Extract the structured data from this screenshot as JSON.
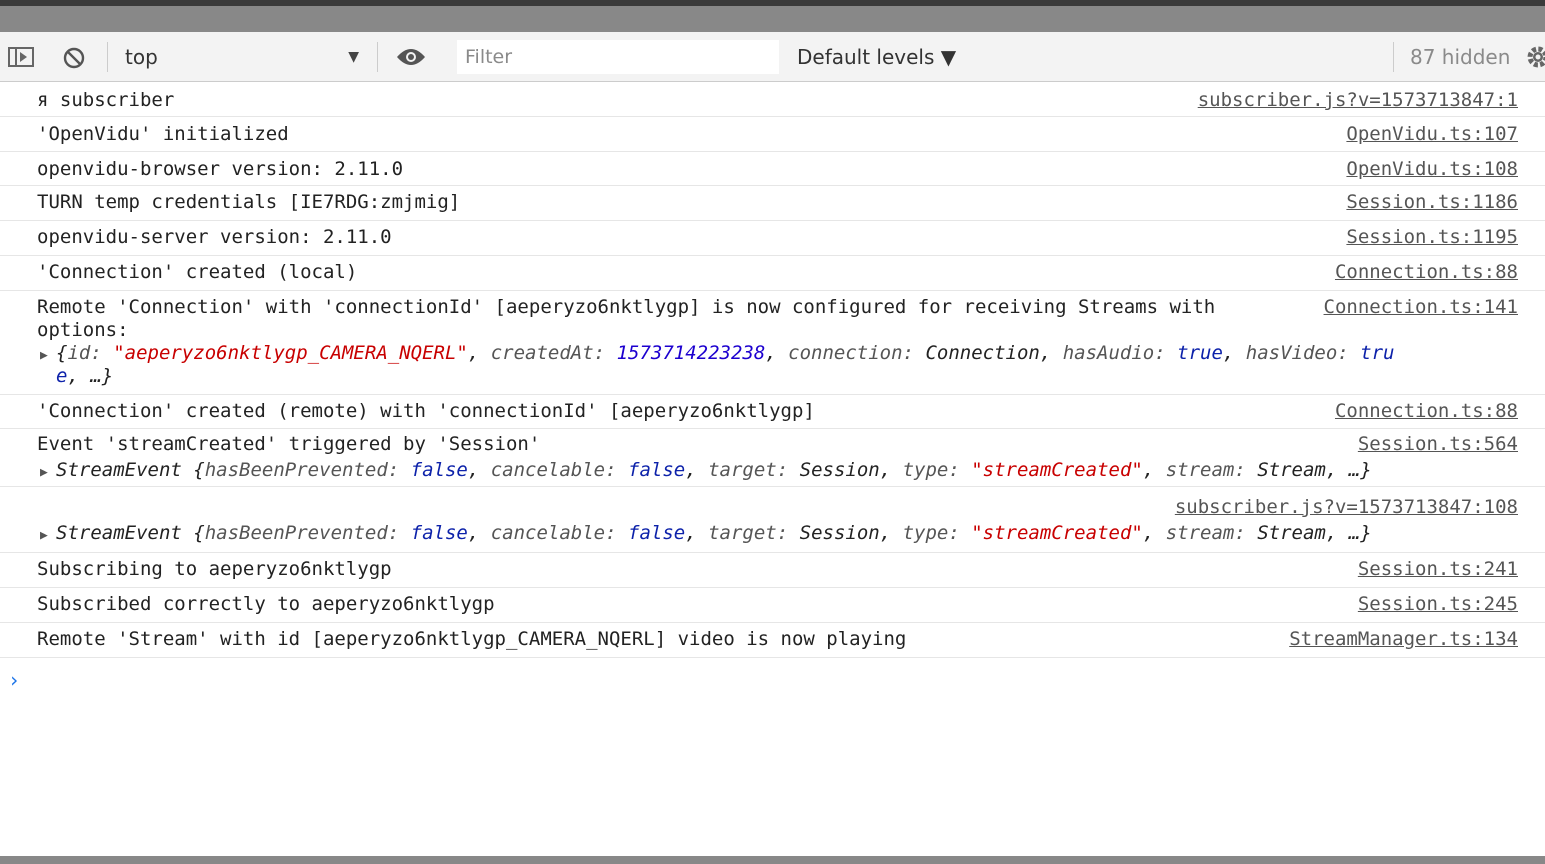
{
  "toolbar": {
    "context": "top",
    "filter_placeholder": "Filter",
    "levels_label": "Default levels ▼",
    "hidden_count": "87 hidden"
  },
  "console": {
    "rows": [
      {
        "text": "я subscriber",
        "source": "subscriber.js?v=1573713847:1"
      },
      {
        "text": "'OpenVidu' initialized",
        "source": "OpenVidu.ts:107"
      },
      {
        "text": "openvidu-browser version: 2.11.0",
        "source": "OpenVidu.ts:108"
      },
      {
        "text": "TURN temp credentials [IE7RDG:zmjmig]",
        "source": "Session.ts:1186"
      },
      {
        "text": "openvidu-server version: 2.11.0",
        "source": "Session.ts:1195"
      },
      {
        "text": "'Connection' created (local)",
        "source": "Connection.ts:88"
      },
      {
        "text": "Remote 'Connection' with 'connectionId' [aeperyzo6nktlygp] is now configured for receiving Streams with",
        "text2": "options:",
        "source": "Connection.ts:141"
      },
      {
        "text": "'Connection' created (remote) with 'connectionId' [aeperyzo6nktlygp]",
        "source": "Connection.ts:88"
      },
      {
        "text": "Event 'streamCreated' triggered by 'Session'",
        "source": "Session.ts:564"
      },
      {
        "text": "",
        "source": "subscriber.js?v=1573713847:108"
      },
      {
        "text": "Subscribing to aeperyzo6nktlygp",
        "source": "Session.ts:241"
      },
      {
        "text": "Subscribed correctly to aeperyzo6nktlygp",
        "source": "Session.ts:245"
      },
      {
        "text": "Remote 'Stream' with id [aeperyzo6nktlygp_CAMERA_NQERL] video is now playing",
        "source": "StreamManager.ts:134"
      }
    ],
    "connection_object": {
      "id_key": "id: ",
      "id_val": "\"aeperyzo6nktlygp_CAMERA_NQERL\"",
      "created_key": "createdAt: ",
      "created_val": "1573714223238",
      "conn_key": "connection: ",
      "conn_val": "Connection",
      "audio_key": "hasAudio: ",
      "audio_val": "true",
      "video_key": "hasVideo: ",
      "video_val_part1": "tru",
      "video_val_part2": "e",
      "ellipsis": ", …}"
    },
    "stream_event": {
      "class_name": "StreamEvent",
      "prevented_key": "hasBeenPrevented: ",
      "prevented_val": "false",
      "cancelable_key": "cancelable: ",
      "cancelable_val": "false",
      "target_key": "target: ",
      "target_val": "Session",
      "type_key": "type: ",
      "type_val": "\"streamCreated\"",
      "stream_key": "stream: ",
      "stream_val": "Stream",
      "ellipsis": ", …}"
    },
    "prompt": "›"
  },
  "colors": {
    "string": "#c80000",
    "number": "#1c00cf",
    "boolean": "#0d22aa",
    "accent": "#1a73e8"
  },
  "icons": [
    "sidebar-toggle-icon",
    "clear-console-icon",
    "eye-icon",
    "gear-icon",
    "expand-triangle-icon"
  ]
}
